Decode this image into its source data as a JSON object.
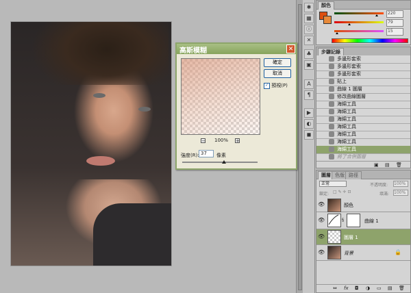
{
  "dialog": {
    "title": "高斯模糊",
    "ok_label": "確定",
    "cancel_label": "取消",
    "preview_label": "預視(P)",
    "zoom": "100%",
    "radius_label": "強度(R):",
    "radius_value": "37",
    "radius_unit": "像素",
    "radius_slider_fraction": 0.55
  },
  "color_panel": {
    "tab_label": "顏色",
    "values": [
      "220",
      "79",
      "15"
    ],
    "slider_positions": [
      0.86,
      0.31,
      0.06
    ],
    "foreground_color": "#dc4f0f",
    "background_color": "#e88a3a"
  },
  "history_panel": {
    "tab_label": "步驟記錄",
    "items": [
      {
        "label": "多邊形套索"
      },
      {
        "label": "多邊形套索"
      },
      {
        "label": "多邊形套索"
      },
      {
        "label": "貼上"
      },
      {
        "label": "曲線 1 圖層"
      },
      {
        "label": "修改曲線圖層"
      },
      {
        "label": "海綿工具"
      },
      {
        "label": "海綿工具"
      },
      {
        "label": "海綿工具"
      },
      {
        "label": "海綿工具"
      },
      {
        "label": "海綿工具"
      },
      {
        "label": "海綿工具"
      },
      {
        "label": "海綿工具"
      },
      {
        "label": "將了合併圖層"
      }
    ],
    "selected_index": 12
  },
  "layers_panel": {
    "tabs": [
      "圖層",
      "色版",
      "路徑"
    ],
    "blend_mode": "正常",
    "opacity_label": "不透明度:",
    "opacity": "100%",
    "lock_label": "鎖定:",
    "fill_label": "填滿:",
    "fill": "100%",
    "layers": [
      {
        "name": "顏色",
        "type": "image"
      },
      {
        "name": "曲線 1",
        "type": "adjustment"
      },
      {
        "name": "圖層 1",
        "type": "image",
        "selected": true
      },
      {
        "name": "背景",
        "type": "background",
        "locked": true
      }
    ]
  },
  "colors": {
    "selection": "#8ea36b",
    "dialog_frame": "#8da66a"
  }
}
